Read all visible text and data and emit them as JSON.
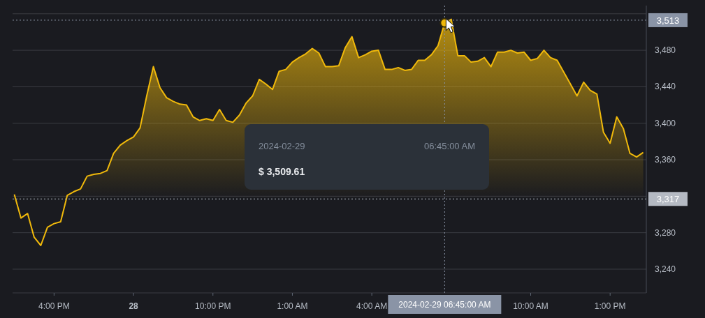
{
  "chart": {
    "chart_data": {
      "type": "area",
      "x": [
        "2024-02-28T14:30",
        "2024-02-28T14:45",
        "2024-02-28T15:00",
        "2024-02-28T15:15",
        "2024-02-28T15:30",
        "2024-02-28T15:45",
        "2024-02-28T16:00",
        "2024-02-28T16:15",
        "2024-02-28T16:30",
        "2024-02-28T16:45",
        "2024-02-28T17:00",
        "2024-02-28T17:15",
        "2024-02-28T17:30",
        "2024-02-28T17:45",
        "2024-02-28T18:00",
        "2024-02-28T18:15",
        "2024-02-28T18:30",
        "2024-02-28T18:45",
        "2024-02-28T19:00",
        "2024-02-28T19:15",
        "2024-02-28T19:30",
        "2024-02-28T19:45",
        "2024-02-28T20:00",
        "2024-02-28T20:15",
        "2024-02-28T20:30",
        "2024-02-28T20:45",
        "2024-02-28T21:00",
        "2024-02-28T21:15",
        "2024-02-28T21:30",
        "2024-02-28T21:45",
        "2024-02-28T22:00",
        "2024-02-28T22:15",
        "2024-02-28T22:30",
        "2024-02-28T22:45",
        "2024-02-28T23:00",
        "2024-02-28T23:15",
        "2024-02-28T23:30",
        "2024-02-28T23:45",
        "2024-02-29T00:00",
        "2024-02-29T00:15",
        "2024-02-29T00:30",
        "2024-02-29T00:45",
        "2024-02-29T01:00",
        "2024-02-29T01:15",
        "2024-02-29T01:30",
        "2024-02-29T01:45",
        "2024-02-29T02:00",
        "2024-02-29T02:15",
        "2024-02-29T02:30",
        "2024-02-29T02:45",
        "2024-02-29T03:00",
        "2024-02-29T03:15",
        "2024-02-29T03:30",
        "2024-02-29T03:45",
        "2024-02-29T04:00",
        "2024-02-29T04:15",
        "2024-02-29T04:30",
        "2024-02-29T04:45",
        "2024-02-29T05:00",
        "2024-02-29T05:15",
        "2024-02-29T05:30",
        "2024-02-29T05:45",
        "2024-02-29T06:00",
        "2024-02-29T06:15",
        "2024-02-29T06:30",
        "2024-02-29T06:45",
        "2024-02-29T07:00",
        "2024-02-29T07:15",
        "2024-02-29T07:30",
        "2024-02-29T07:45",
        "2024-02-29T08:00",
        "2024-02-29T08:15",
        "2024-02-29T08:30",
        "2024-02-29T08:45",
        "2024-02-29T09:00",
        "2024-02-29T09:15",
        "2024-02-29T09:30",
        "2024-02-29T09:45",
        "2024-02-29T10:00",
        "2024-02-29T10:15",
        "2024-02-29T10:30",
        "2024-02-29T10:45",
        "2024-02-29T11:00",
        "2024-02-29T11:15",
        "2024-02-29T11:30",
        "2024-02-29T11:45",
        "2024-02-29T12:00",
        "2024-02-29T12:15",
        "2024-02-29T12:30",
        "2024-02-29T12:45",
        "2024-02-29T13:00",
        "2024-02-29T13:15",
        "2024-02-29T13:30",
        "2024-02-29T13:45",
        "2024-02-29T14:00",
        "2024-02-29T14:15"
      ],
      "series": [
        {
          "color": "#f0b90b",
          "values": [
            3322,
            3296,
            3301,
            3275,
            3266,
            3286,
            3290,
            3292,
            3321,
            3325,
            3328,
            3342,
            3344,
            3345,
            3348,
            3367,
            3376,
            3381,
            3385,
            3395,
            3430,
            3462,
            3439,
            3428,
            3424,
            3421,
            3420,
            3407,
            3403,
            3405,
            3403,
            3415,
            3403,
            3401,
            3409,
            3422,
            3430,
            3448,
            3443,
            3437,
            3457,
            3459,
            3467,
            3472,
            3476,
            3482,
            3477,
            3462,
            3462,
            3463,
            3483,
            3495,
            3472,
            3475,
            3479,
            3480,
            3459,
            3459,
            3461,
            3458,
            3459,
            3469,
            3469,
            3475,
            3485,
            3510,
            3514,
            3474,
            3474,
            3467,
            3468,
            3472,
            3462,
            3478,
            3478,
            3480,
            3477,
            3478,
            3469,
            3471,
            3480,
            3472,
            3469,
            3456,
            3443,
            3430,
            3445,
            3436,
            3432,
            3390,
            3378,
            3407,
            3394,
            3367,
            3363,
            3368
          ]
        }
      ],
      "xlim": [
        "2024-02-28T14:26",
        "2024-02-29T14:22"
      ],
      "ylim": [
        3214,
        3529
      ],
      "xticks": [
        {
          "value": "2024-02-28T16:00",
          "label": "4:00 PM"
        },
        {
          "value": "2024-02-28T19:00",
          "label": "28"
        },
        {
          "value": "2024-02-28T22:00",
          "label": "10:00 PM"
        },
        {
          "value": "2024-02-29T01:00",
          "label": "1:00 AM"
        },
        {
          "value": "2024-02-29T04:00",
          "label": "4:00 AM"
        },
        {
          "value": "2024-02-29T10:00",
          "label": "10:00 AM"
        },
        {
          "value": "2024-02-29T13:00",
          "label": "1:00 PM"
        }
      ],
      "yticks": [
        {
          "value": 3240,
          "label": "3,240"
        },
        {
          "value": 3280,
          "label": "3,280"
        },
        {
          "value": 3360,
          "label": "3,360"
        },
        {
          "value": 3400,
          "label": "3,400"
        },
        {
          "value": 3440,
          "label": "3,440"
        },
        {
          "value": 3480,
          "label": "3,480"
        }
      ],
      "grid": true,
      "ref_lines": [
        {
          "axis": "y",
          "value": 3317,
          "label": "3,317",
          "color": "#b5bac3"
        },
        {
          "axis": "y",
          "value": 3513,
          "label": "3,513",
          "color": "#8a94a6"
        },
        {
          "axis": "x",
          "value": "2024-02-29T06:45",
          "label": "2024-02-29 06:45:00 AM",
          "color": "#8a94a6"
        }
      ]
    },
    "tooltip": {
      "date": "2024-02-29",
      "time": "06:45:00 AM",
      "price": "$ 3,509.61"
    }
  }
}
